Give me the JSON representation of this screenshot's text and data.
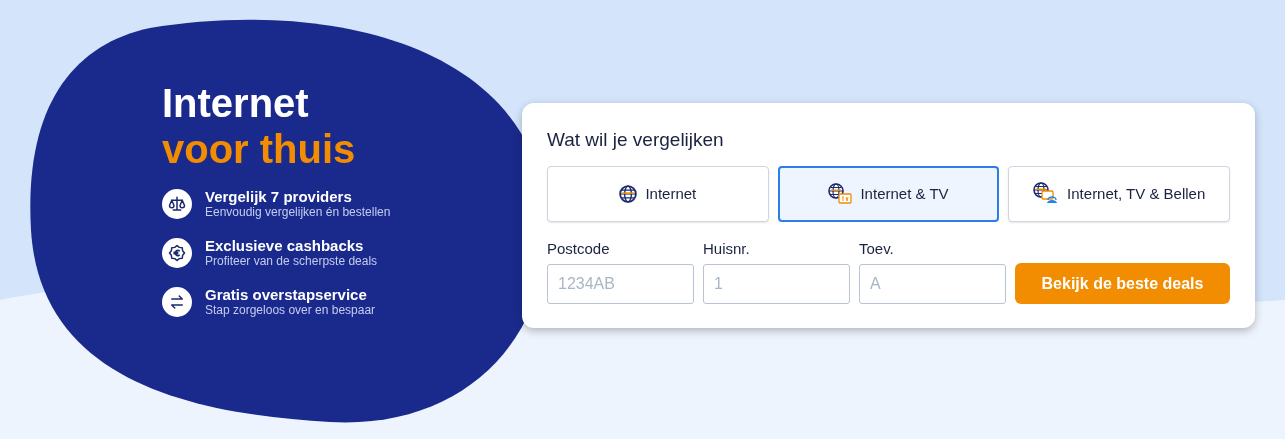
{
  "hero": {
    "title_line1": "Internet",
    "title_line2": "voor thuis",
    "features": [
      {
        "kind": "scale",
        "title": "Vergelijk 7 providers",
        "subtitle": "Eenvoudig vergelijken én bestellen"
      },
      {
        "kind": "euro",
        "title": "Exclusieve cashbacks",
        "subtitle": "Profiteer van de scherpste deals"
      },
      {
        "kind": "swap",
        "title": "Gratis overstapservice",
        "subtitle": "Stap zorgeloos over en bespaar"
      }
    ]
  },
  "form": {
    "title": "Wat wil je vergelijken",
    "tabs": [
      {
        "kind": "internet",
        "label": "Internet",
        "selected": false
      },
      {
        "kind": "internet_tv",
        "label": "Internet & TV",
        "selected": true
      },
      {
        "kind": "internet_tv_phone",
        "label": "Internet, TV & Bellen",
        "selected": false
      }
    ],
    "fields": [
      {
        "label": "Postcode",
        "placeholder": "1234AB"
      },
      {
        "label": "Huisnr.",
        "placeholder": "1"
      },
      {
        "label": "Toev.",
        "placeholder": "A"
      }
    ],
    "submit": "Bekijk de beste deals"
  }
}
